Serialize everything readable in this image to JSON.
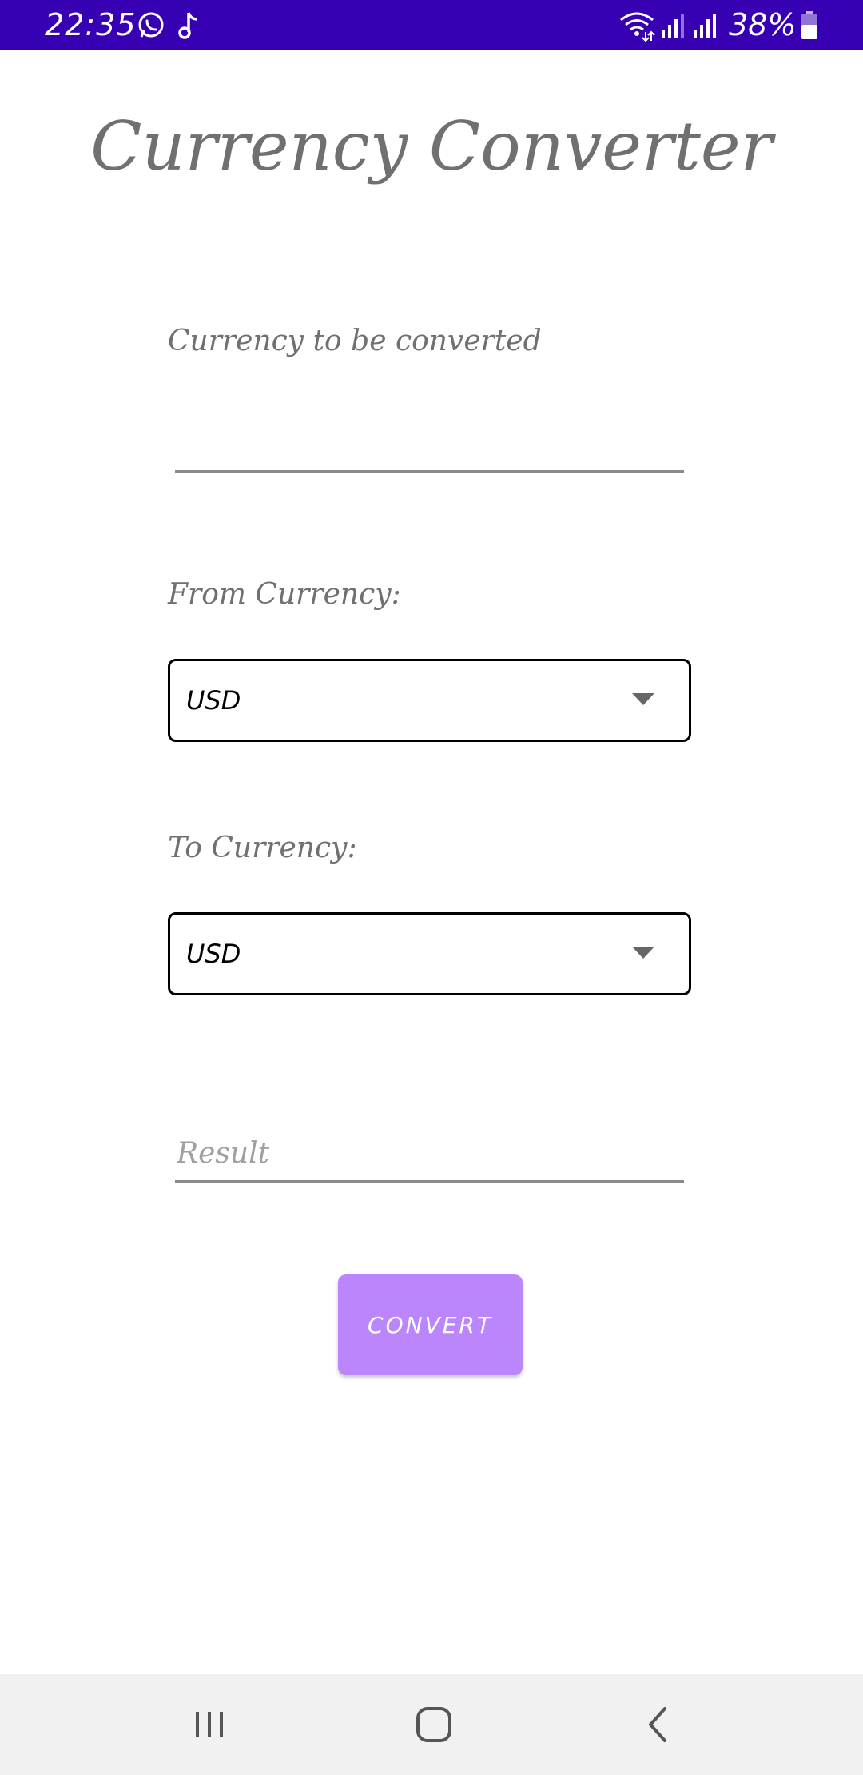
{
  "status_bar": {
    "time": "22:35",
    "battery_percent": "38%",
    "background_color": "#3700b3",
    "icons": [
      "whatsapp-icon",
      "tiktok-icon",
      "wifi-icon",
      "signal-icon",
      "signal-icon",
      "battery-icon"
    ]
  },
  "app": {
    "title": "Currency Converter"
  },
  "amount_field": {
    "label": "Currency to be converted",
    "value": "",
    "placeholder": ""
  },
  "from_currency": {
    "label": "From Currency:",
    "selected": "USD"
  },
  "to_currency": {
    "label": "To Currency:",
    "selected": "USD"
  },
  "result_field": {
    "value": "",
    "placeholder": "Result"
  },
  "convert_button": {
    "label": "CONVERT",
    "color": "#bb86fc"
  },
  "nav_bar": {
    "background_color": "#f1f1f1",
    "buttons": [
      "recents-icon",
      "home-icon",
      "back-icon"
    ]
  }
}
